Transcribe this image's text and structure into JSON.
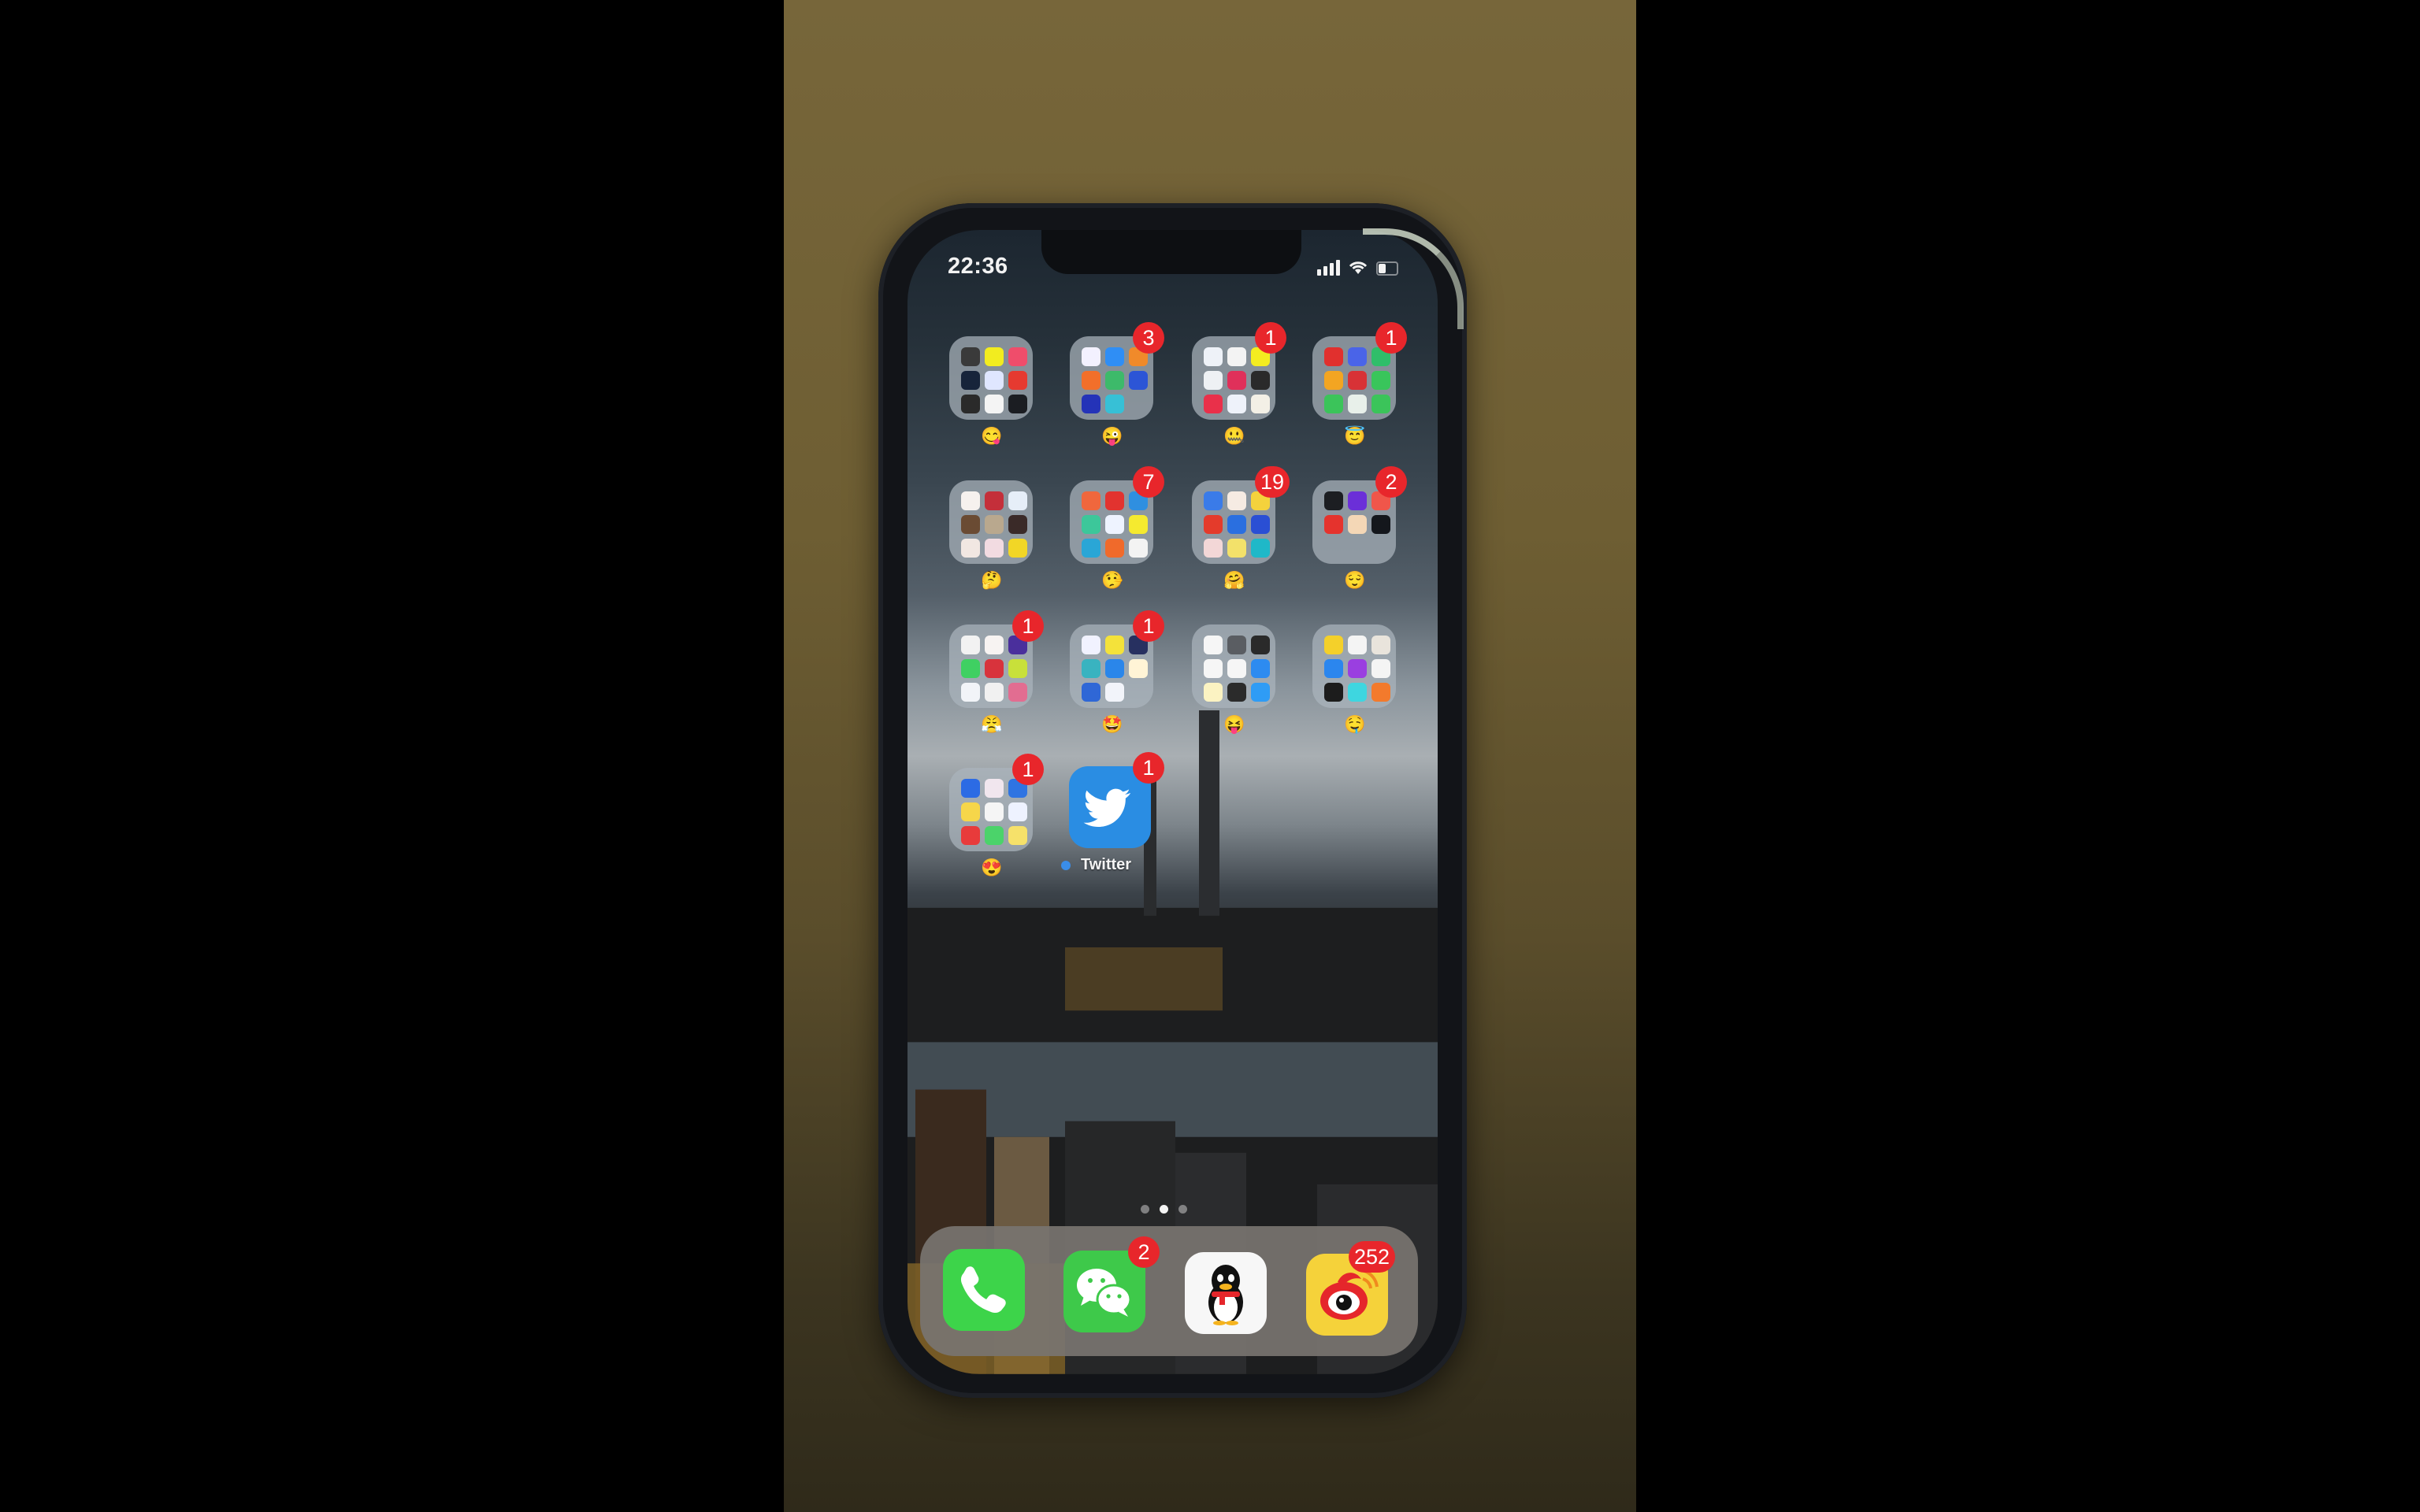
{
  "status_bar": {
    "time": "22:36",
    "signal_bars": 4,
    "wifi": true,
    "battery_level": 0.45
  },
  "home_screen": {
    "page_count": 3,
    "active_page": 2,
    "folders": [
      {
        "row": 1,
        "col": 1,
        "label_emoji": "😋",
        "badge": null,
        "mini_icons": [
          "#3a3a3a",
          "#f2ec1f",
          "#ef4d6b",
          "#17243a",
          "#dfe6ff",
          "#e63a30",
          "#2a2a2a",
          "#f4f4f4",
          "#1b1d22"
        ]
      },
      {
        "row": 1,
        "col": 2,
        "label_emoji": "😜",
        "badge": "3",
        "mini_icons": [
          "#f3f1ff",
          "#2f8ef5",
          "#f08a2a",
          "#f26f2a",
          "#3dba6a",
          "#2c55d6",
          "#2433b8",
          "#37c0d6",
          ""
        ]
      },
      {
        "row": 1,
        "col": 3,
        "label_emoji": "🤐",
        "badge": "1",
        "mini_icons": [
          "#eef2f8",
          "#f3f3f3",
          "#f4ec20",
          "#eef1f4",
          "#e0305a",
          "#2a2a2a",
          "#e9304a",
          "#eef2fa",
          "#f3f0e6"
        ]
      },
      {
        "row": 1,
        "col": 4,
        "label_emoji": "😇",
        "badge": "1",
        "mini_icons": [
          "#e1302e",
          "#4a64e8",
          "#2fbe6a",
          "#f3a522",
          "#d83236",
          "#39c55b",
          "#3bc45a",
          "#e8f0ea",
          "#3bc45a"
        ]
      },
      {
        "row": 2,
        "col": 1,
        "label_emoji": "🤔",
        "badge": null,
        "mini_icons": [
          "#f6f1ee",
          "#c42f3a",
          "#e6eef8",
          "#6a4b33",
          "#b9a88e",
          "#3a2a28",
          "#f1e7e2",
          "#f2dbe1",
          "#f2d626"
        ]
      },
      {
        "row": 2,
        "col": 2,
        "label_emoji": "🤥",
        "badge": "7",
        "mini_icons": [
          "#f0673d",
          "#e2332f",
          "#2f8fe0",
          "#3cc79a",
          "#eef3ff",
          "#f5ea2f",
          "#2aa6d6",
          "#f06a2b",
          "#f3f3f3"
        ]
      },
      {
        "row": 2,
        "col": 3,
        "label_emoji": "🤗",
        "badge": "19",
        "mini_icons": [
          "#3a7be8",
          "#f6ebe3",
          "#f4d23c",
          "#e43b2b",
          "#2a6fe0",
          "#2a4fd4",
          "#f3d7d7",
          "#f3e16a",
          "#1fb8c8"
        ]
      },
      {
        "row": 2,
        "col": 4,
        "label_emoji": "😌",
        "badge": "2",
        "mini_icons": [
          "#1c1e22",
          "#6b2fd8",
          "#f0564a",
          "#e5332d",
          "#f4d7b6",
          "#14171c",
          "",
          "",
          ""
        ]
      },
      {
        "row": 3,
        "col": 1,
        "label_emoji": "😤",
        "badge": "1",
        "mini_icons": [
          "#f2f2f2",
          "#f7f3f2",
          "#4a2f9c",
          "#3fd062",
          "#d8333c",
          "#c8e03a",
          "#f2f4f8",
          "#f1f1f1",
          "#e26d91"
        ]
      },
      {
        "row": 3,
        "col": 2,
        "label_emoji": "🤩",
        "badge": "1",
        "mini_icons": [
          "#f1f2ff",
          "#f4e23a",
          "#273060",
          "#39b3c0",
          "#2a86ea",
          "#fff4d6",
          "#2f67d6",
          "#f2f4fa",
          ""
        ]
      },
      {
        "row": 3,
        "col": 3,
        "label_emoji": "😝",
        "badge": null,
        "mini_icons": [
          "#f6f6f6",
          "#5a5d62",
          "#2a2a2a",
          "#f6f6f6",
          "#f6f6f6",
          "#2d8bf0",
          "#fbf3c2",
          "#2b2b2b",
          "#2f9cf5"
        ]
      },
      {
        "row": 3,
        "col": 4,
        "label_emoji": "🤤",
        "badge": null,
        "mini_icons": [
          "#f4d02a",
          "#f4f4f4",
          "#e9e4dc",
          "#2b86ee",
          "#9a3fe0",
          "#f4f4f4",
          "#1c1c1c",
          "#3ed6e0",
          "#f37a2c"
        ]
      },
      {
        "row": 4,
        "col": 1,
        "label_emoji": "😍",
        "badge": "1",
        "mini_icons": [
          "#2c6be4",
          "#f1e6ee",
          "#2f74e2",
          "#f6d64a",
          "#f5f5f5",
          "#eef2ff",
          "#e83b3b",
          "#4bd36a",
          "#f6e16a"
        ]
      }
    ],
    "apps": [
      {
        "name": "Twitter",
        "label": "Twitter",
        "badge": "1",
        "color": "#2a8de3",
        "new_install_dot": "#3a8de8"
      }
    ]
  },
  "dock": {
    "apps": [
      {
        "name": "Phone",
        "badge": null,
        "color": "#3dd44a"
      },
      {
        "name": "WeChat",
        "badge": "2",
        "color": "#3ec94a"
      },
      {
        "name": "QQ",
        "badge": null,
        "color": "#f7f7f7"
      },
      {
        "name": "Weibo",
        "badge": "252",
        "color": "#f5d23a"
      }
    ]
  },
  "colors": {
    "badge": "#e8262b",
    "folder_bg": "#aab4bc"
  }
}
